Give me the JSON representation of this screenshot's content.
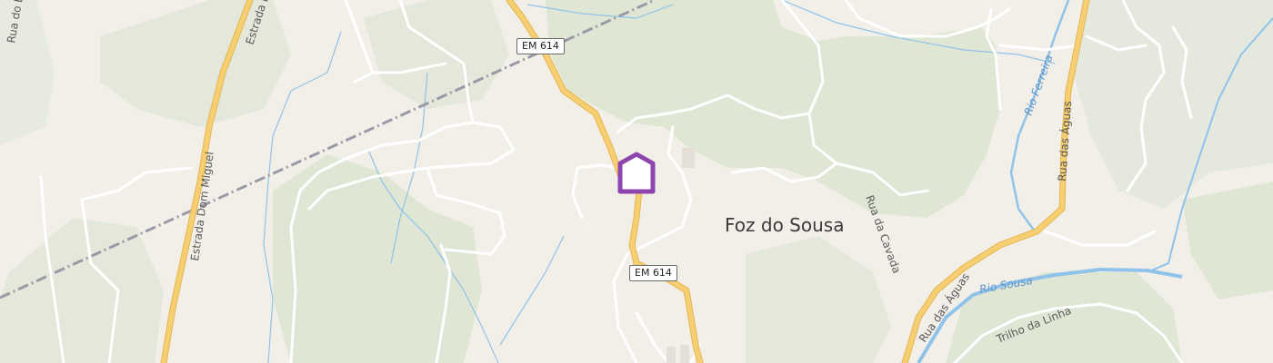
{
  "map": {
    "place_label": "Foz do Sousa",
    "road_shields": [
      "EM 614",
      "EM 614"
    ],
    "street_labels": {
      "rua_top_left": "Rua do E",
      "estrada_dom_miguel_upper": "Estrada Dom",
      "estrada_dom_miguel_lower": "Estrada Dom Miguel",
      "rua_da_cavada": "Rua da Cavada",
      "rua_das_aguas_upper": "Rua das Águas",
      "rua_das_aguas_lower": "Rua das Águas",
      "trilho_da_linha": "Trilho da Linha"
    },
    "water_labels": {
      "rio_ferreira": "Rio Ferreira",
      "rio_sousa": "Rio Sousa"
    },
    "marker": {
      "icon": "home-pin-icon",
      "color": "#8e44ad"
    },
    "colors": {
      "background": "#f2efe9",
      "forest": "#dfe6d3",
      "primary_road": "#f6cf72",
      "water": "#8fc3ea",
      "railway": "#9a9aa6"
    }
  }
}
